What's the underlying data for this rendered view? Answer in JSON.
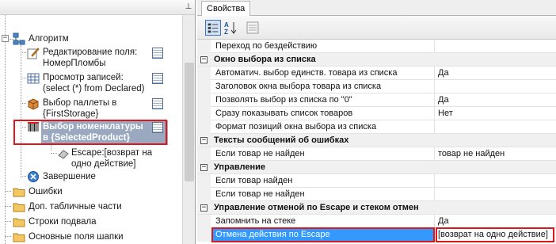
{
  "left_pane": {
    "tree": [
      {
        "label": "Алгоритм",
        "icon": "algorithm-icon"
      },
      {
        "label": "Редактирование поля:\nНомерПломбы",
        "icon": "pencil-icon"
      },
      {
        "label": "Просмотр записей:\n(select (*) from Declared)",
        "icon": "table-icon"
      },
      {
        "label": "Выбор паллеты в\n{FirstStorage}",
        "icon": "box-icon"
      },
      {
        "label": "Выбор номенклатуры\nв {SelectedProduct}",
        "icon": "barcode-icon"
      },
      {
        "label": "Escape:[возврат на\nодно действие]",
        "icon": "eraser-icon"
      },
      {
        "label": "Завершение",
        "icon": "finish-icon"
      },
      {
        "label": "Ошибки",
        "icon": "folder-icon"
      },
      {
        "label": "Доп. табличные части",
        "icon": "folder-icon"
      },
      {
        "label": "Строки подвала",
        "icon": "folder-icon"
      },
      {
        "label": "Основные поля шапки",
        "icon": "folder-icon"
      }
    ]
  },
  "right_pane": {
    "tab_label": "Свойства",
    "toolbar": {
      "categorized": "categorized-icon",
      "alphabetical": "sort-az-icon",
      "pages": "property-pages-icon"
    },
    "rows": [
      {
        "type": "prop",
        "name": "Переход по бездействию",
        "value": ""
      },
      {
        "type": "cat",
        "name": "Окно выбора из списка"
      },
      {
        "type": "prop",
        "name": "Автоматич. выбор единств. товара из списка",
        "value": "Да"
      },
      {
        "type": "prop",
        "name": "Заголовок окна выбора товара из списка",
        "value": ""
      },
      {
        "type": "prop",
        "name": "Позволять выбор из списка по \"0\"",
        "value": "Да"
      },
      {
        "type": "prop",
        "name": "Сразу показывать список товаров",
        "value": "Нет"
      },
      {
        "type": "prop",
        "name": "Формат позиций окна выбора из списка",
        "value": ""
      },
      {
        "type": "cat",
        "name": "Тексты сообщений об ошибках"
      },
      {
        "type": "prop",
        "name": "Если товар не найден",
        "value": "товар не найден"
      },
      {
        "type": "cat",
        "name": "Управление"
      },
      {
        "type": "prop",
        "name": "Если товар найден",
        "value": ""
      },
      {
        "type": "prop",
        "name": "Если товар не найден",
        "value": ""
      },
      {
        "type": "cat",
        "name": "Управление отменой по Escape и стеком отмен"
      },
      {
        "type": "prop",
        "name": "Запомнить на стеке",
        "value": "Да"
      },
      {
        "type": "prop",
        "name": "Отмена действия по Escape",
        "value": "[возврат на одно действие]"
      }
    ]
  },
  "colors": {
    "highlight_red": "#e0161d",
    "selection_blue": "#3399ff",
    "tree_selection": "#9aa9bf"
  }
}
